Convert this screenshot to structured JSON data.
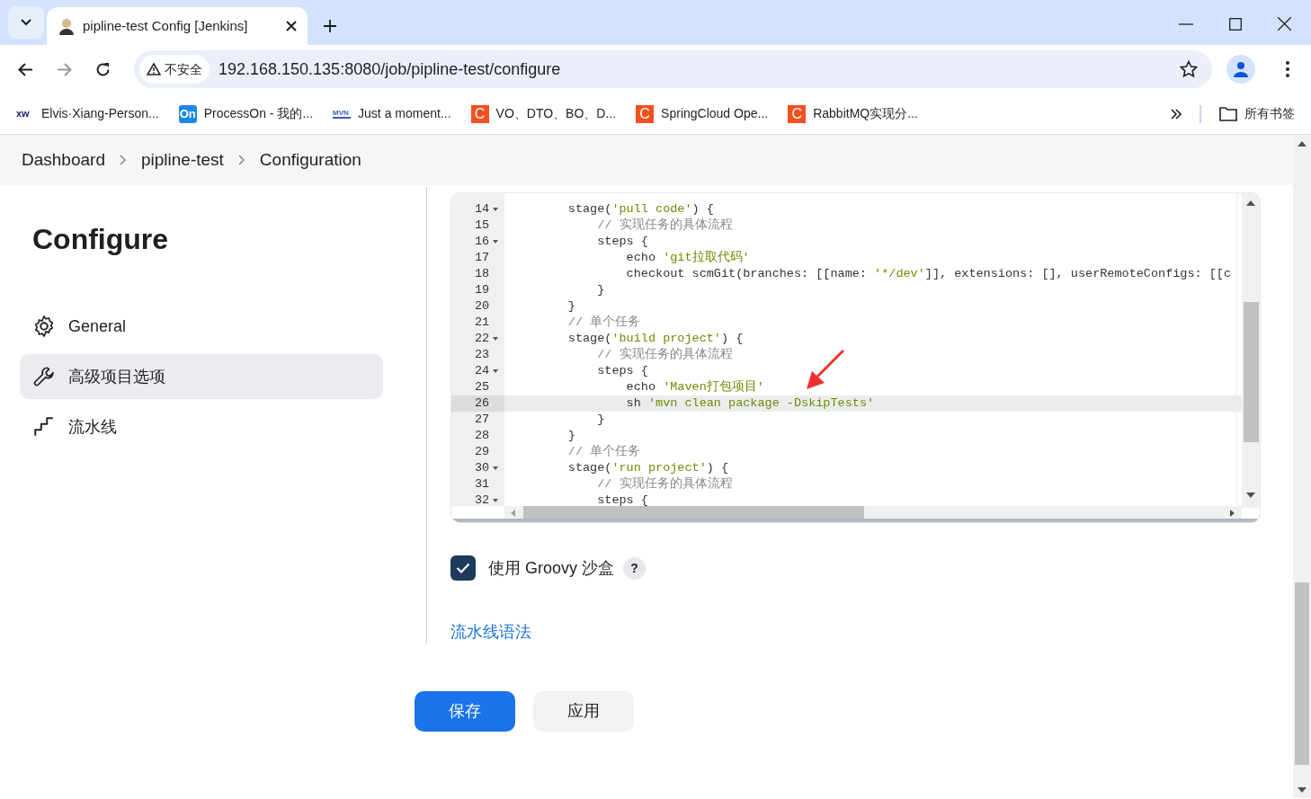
{
  "browser": {
    "tab_title": "pipline-test Config [Jenkins]",
    "security_label": "不安全",
    "url": "192.168.150.135:8080/job/pipline-test/configure",
    "bookmarks": [
      {
        "badge": "xw",
        "kind": "plain",
        "label": "Elvis·Xiang-Person..."
      },
      {
        "badge": "On",
        "kind": "blue",
        "label": "ProcessOn - 我的..."
      },
      {
        "badge": "MVN",
        "kind": "mvn",
        "label": "Just a moment..."
      },
      {
        "badge": "C",
        "kind": "red",
        "label": "VO、DTO、BO、D..."
      },
      {
        "badge": "C",
        "kind": "red",
        "label": "SpringCloud Ope..."
      },
      {
        "badge": "C",
        "kind": "red",
        "label": "RabbitMQ实现分..."
      }
    ],
    "all_bookmarks": "所有书签"
  },
  "breadcrumb": [
    "Dashboard",
    "pipline-test",
    "Configuration"
  ],
  "sidebar": {
    "title": "Configure",
    "items": [
      {
        "label": "General",
        "kind": "gear",
        "selected": false
      },
      {
        "label": "高级项目选项",
        "kind": "wrench",
        "selected": true
      },
      {
        "label": "流水线",
        "kind": "pipe",
        "selected": false
      }
    ]
  },
  "editor": {
    "lines": [
      {
        "number": "14",
        "fold": true,
        "active": false,
        "tokens": [
          {
            "kind": "plain",
            "text": "        stage("
          },
          {
            "kind": "string",
            "text": "'pull code'"
          },
          {
            "kind": "plain",
            "text": ") {"
          }
        ]
      },
      {
        "number": "15",
        "fold": false,
        "active": false,
        "tokens": [
          {
            "kind": "comment",
            "text": "            // 实现任务的具体流程"
          }
        ]
      },
      {
        "number": "16",
        "fold": true,
        "active": false,
        "tokens": [
          {
            "kind": "plain",
            "text": "            steps {"
          }
        ]
      },
      {
        "number": "17",
        "fold": false,
        "active": false,
        "tokens": [
          {
            "kind": "plain",
            "text": "                echo "
          },
          {
            "kind": "string",
            "text": "'git拉取代码'"
          }
        ]
      },
      {
        "number": "18",
        "fold": false,
        "active": false,
        "tokens": [
          {
            "kind": "plain",
            "text": "                checkout scmGit(branches: [[name: "
          },
          {
            "kind": "string",
            "text": "'*/dev'"
          },
          {
            "kind": "plain",
            "text": "]], extensions: [], userRemoteConfigs: [[c"
          }
        ]
      },
      {
        "number": "19",
        "fold": false,
        "active": false,
        "tokens": [
          {
            "kind": "plain",
            "text": "            }"
          }
        ]
      },
      {
        "number": "20",
        "fold": false,
        "active": false,
        "tokens": [
          {
            "kind": "plain",
            "text": "        }"
          }
        ]
      },
      {
        "number": "21",
        "fold": false,
        "active": false,
        "tokens": [
          {
            "kind": "comment",
            "text": "        // 单个任务"
          }
        ]
      },
      {
        "number": "22",
        "fold": true,
        "active": false,
        "tokens": [
          {
            "kind": "plain",
            "text": "        stage("
          },
          {
            "kind": "string",
            "text": "'build project'"
          },
          {
            "kind": "plain",
            "text": ") {"
          }
        ]
      },
      {
        "number": "23",
        "fold": false,
        "active": false,
        "tokens": [
          {
            "kind": "comment",
            "text": "            // 实现任务的具体流程"
          }
        ]
      },
      {
        "number": "24",
        "fold": true,
        "active": false,
        "tokens": [
          {
            "kind": "plain",
            "text": "            steps {"
          }
        ]
      },
      {
        "number": "25",
        "fold": false,
        "active": false,
        "tokens": [
          {
            "kind": "plain",
            "text": "                echo "
          },
          {
            "kind": "string",
            "text": "'Maven打包项目'"
          }
        ]
      },
      {
        "number": "26",
        "fold": false,
        "active": true,
        "tokens": [
          {
            "kind": "plain",
            "text": "                sh "
          },
          {
            "kind": "string",
            "text": "'mvn clean package -DskipTests'"
          }
        ]
      },
      {
        "number": "27",
        "fold": false,
        "active": false,
        "tokens": [
          {
            "kind": "plain",
            "text": "            }"
          }
        ]
      },
      {
        "number": "28",
        "fold": false,
        "active": false,
        "tokens": [
          {
            "kind": "plain",
            "text": "        }"
          }
        ]
      },
      {
        "number": "29",
        "fold": false,
        "active": false,
        "tokens": [
          {
            "kind": "comment",
            "text": "        // 单个任务"
          }
        ]
      },
      {
        "number": "30",
        "fold": true,
        "active": false,
        "tokens": [
          {
            "kind": "plain",
            "text": "        stage("
          },
          {
            "kind": "string",
            "text": "'run project'"
          },
          {
            "kind": "plain",
            "text": ") {"
          }
        ]
      },
      {
        "number": "31",
        "fold": false,
        "active": false,
        "tokens": [
          {
            "kind": "comment",
            "text": "            // 实现任务的具体流程"
          }
        ]
      },
      {
        "number": "32",
        "fold": true,
        "active": false,
        "tokens": [
          {
            "kind": "plain",
            "text": "            steps {"
          }
        ]
      }
    ]
  },
  "sandbox": {
    "label": "使用 Groovy 沙盒",
    "checked": true,
    "help": "?"
  },
  "syntax_link": "流水线语法",
  "buttons": [
    {
      "label": "保存",
      "kind": "primary"
    },
    {
      "label": "应用",
      "kind": "secondary"
    }
  ]
}
